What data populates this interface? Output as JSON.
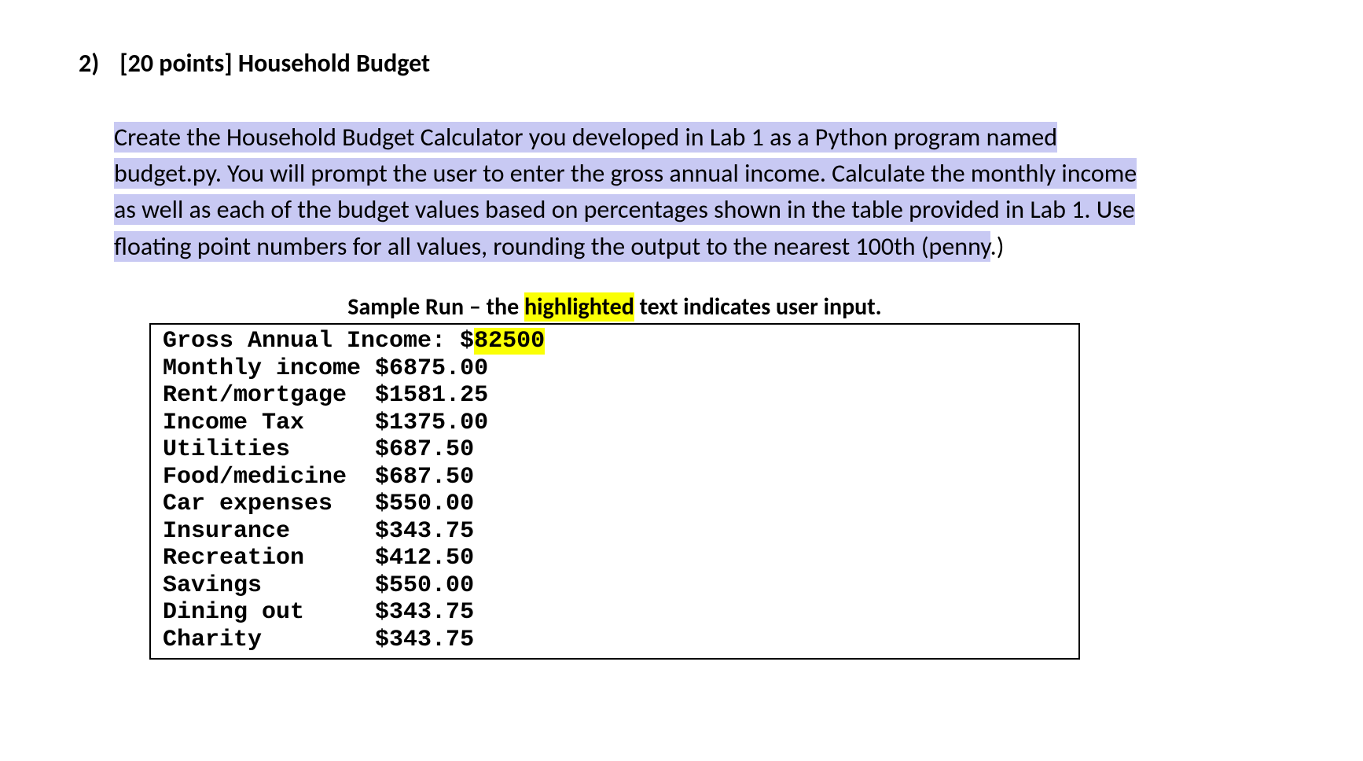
{
  "question": {
    "number": "2)",
    "points": "[20 points]",
    "title": "Household Budget"
  },
  "instructions": {
    "line1": "Create the Household Budget Calculator you developed in Lab 1 as a Python program named",
    "line2": "budget.py. You will prompt the user to enter the gross annual income. Calculate the monthly income",
    "line3": "as well as each of the budget values based on percentages shown in the table provided in Lab 1. Use",
    "line4_a": "floating point numbers for all values, rounding the output to the nearest 100th (penny",
    "line4_b": ".)"
  },
  "sample_header": {
    "prefix": "Sample Run – the ",
    "highlighted": "highlighted",
    "suffix": " text indicates user input."
  },
  "sample": {
    "prompt_label": "Gross Annual Income: $",
    "user_input": "82500",
    "rows": [
      {
        "label": "Monthly income ",
        "value": "$6875.00"
      },
      {
        "label": "Rent/mortgage  ",
        "value": "$1581.25"
      },
      {
        "label": "Income Tax     ",
        "value": "$1375.00"
      },
      {
        "label": "Utilities      ",
        "value": "$687.50"
      },
      {
        "label": "Food/medicine  ",
        "value": "$687.50"
      },
      {
        "label": "Car expenses   ",
        "value": "$550.00"
      },
      {
        "label": "Insurance      ",
        "value": "$343.75"
      },
      {
        "label": "Recreation     ",
        "value": "$412.50"
      },
      {
        "label": "Savings        ",
        "value": "$550.00"
      },
      {
        "label": "Dining out     ",
        "value": "$343.75"
      },
      {
        "label": "Charity        ",
        "value": "$343.75"
      }
    ]
  }
}
